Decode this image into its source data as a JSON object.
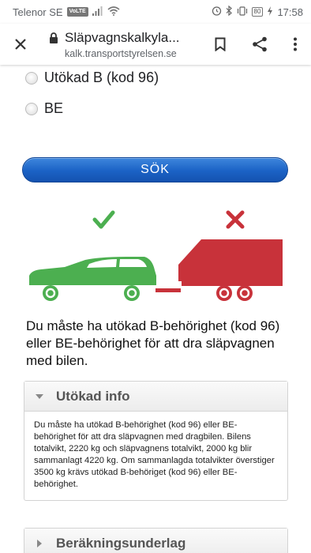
{
  "status_bar": {
    "carrier": "Telenor SE",
    "volte": "VoLTE",
    "battery": "80",
    "time": "17:58"
  },
  "browser": {
    "tab_title": "Släpvagnskalkyla...",
    "url": "kalk.transportstyrelsen.se"
  },
  "options": [
    {
      "label": "Utökad B (kod 96)",
      "checked": false
    },
    {
      "label": "BE",
      "checked": false
    }
  ],
  "search_button": "SÖK",
  "illustration": {
    "car_status": "allowed",
    "trailer_status": "not-allowed",
    "colors": {
      "car": "#4caf50",
      "trailer": "#c8323a",
      "check": "#4caf50",
      "cross": "#c8323a"
    }
  },
  "result_text": "Du måste ha utökad B-behörighet (kod 96) eller BE-behörighet för att dra släpvagnen med bilen.",
  "accordions": [
    {
      "title": "Utökad info",
      "expanded": true,
      "body": "Du måste ha utökad B-behörighet (kod 96) eller BE-behörighet för att dra släpvagnen med dragbilen. Bilens totalvikt, 2220 kg och släpvagnens totalvikt, 2000 kg blir sammanlagt 4220 kg. Om sammanlagda totalvikter överstiger 3500 kg krävs utökad B-behöriget (kod 96) eller BE-behörighet."
    },
    {
      "title": "Beräkningsunderlag",
      "expanded": false
    }
  ]
}
